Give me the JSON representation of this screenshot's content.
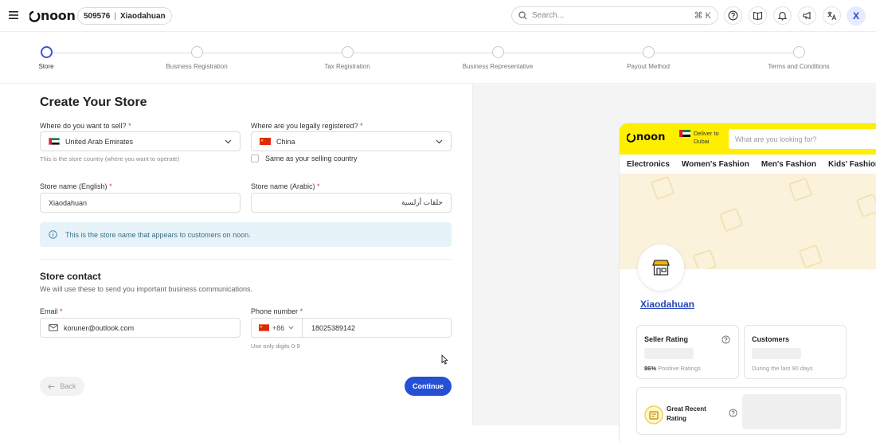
{
  "header": {
    "logo_text": "noon",
    "store_id": "509576",
    "store_name": "Xiaodahuan",
    "search_placeholder": "Search...",
    "search_shortcut": "⌘ K",
    "avatar_initial": "X"
  },
  "stepper": {
    "steps": [
      {
        "label": "Store",
        "active": true
      },
      {
        "label": "Business Registration",
        "active": false
      },
      {
        "label": "Tax Registration",
        "active": false
      },
      {
        "label": "Business Representative",
        "active": false
      },
      {
        "label": "Payout Method",
        "active": false
      },
      {
        "label": "Terms and Conditions",
        "active": false
      }
    ]
  },
  "form": {
    "title": "Create Your Store",
    "sell_country": {
      "label": "Where do you want to sell?",
      "required_mark": "*",
      "value": "United Arab Emirates",
      "hint": "This is the store country (where you want to operate)"
    },
    "registered_country": {
      "label": "Where are you legally registered?",
      "required_mark": "*",
      "value": "China"
    },
    "same_as_selling": {
      "label": "Same as your selling country",
      "checked": false
    },
    "store_name_en": {
      "label": "Store name (English)",
      "required_mark": "*",
      "value": "Xiaodahuan"
    },
    "store_name_ar": {
      "label": "Store name (Arabic)",
      "required_mark": "*",
      "value": "حلقات أرلسية"
    },
    "info_text": "This is the store name that appears to customers on noon.",
    "contact_title": "Store contact",
    "contact_sub": "We will use these to send you important business communications.",
    "email": {
      "label": "Email",
      "required_mark": "*",
      "value": "koruner@outlook.com"
    },
    "phone": {
      "label": "Phone number",
      "required_mark": "*",
      "country_code": "+86",
      "value": "18025389142",
      "hint": "Use only digits 0-9"
    },
    "back_label": "Back",
    "continue_label": "Continue"
  },
  "preview": {
    "logo_text": "noon",
    "deliver_to": "Deliver to",
    "deliver_city": "Dubai",
    "search_placeholder": "What are you looking for?",
    "nav": [
      "Electronics",
      "Women's Fashion",
      "Men's Fashion",
      "Kids' Fashion"
    ],
    "store_name": "Xiaodahuan",
    "seller_rating": {
      "title": "Seller Rating",
      "percent": "86%",
      "caption": "Positive Ratings"
    },
    "customers": {
      "title": "Customers",
      "caption": "During the last 90 days"
    },
    "badge": {
      "title_line1": "Great Recent",
      "title_line2": "Rating"
    }
  },
  "colors": {
    "accent": "#2450d6",
    "noon_yellow": "#feee00",
    "link": "#2346b8"
  }
}
